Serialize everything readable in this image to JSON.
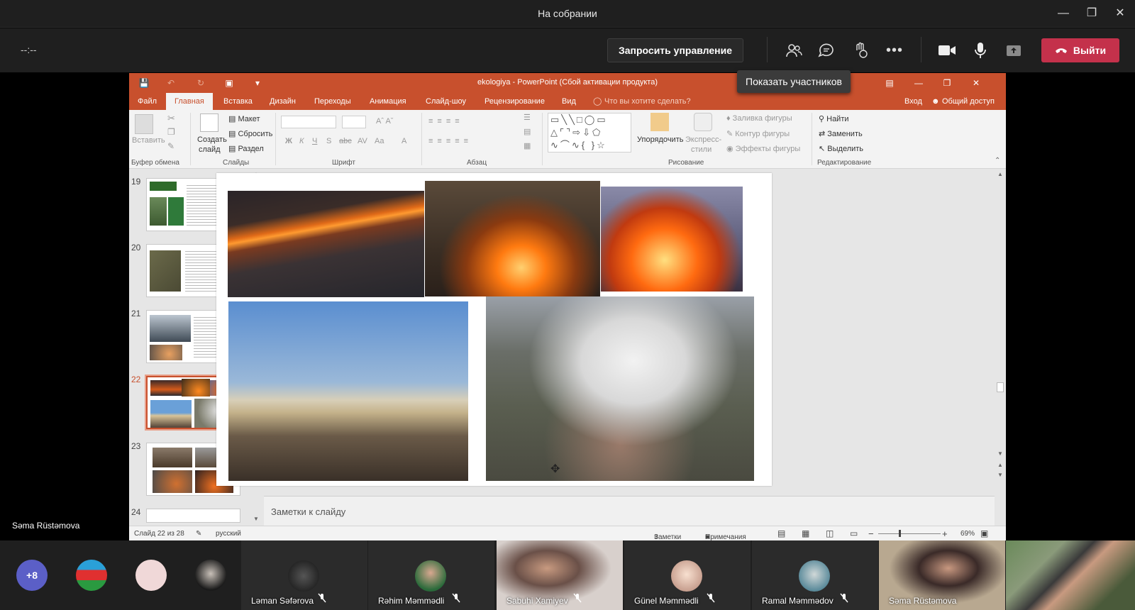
{
  "window": {
    "title": "На собрании"
  },
  "toolbar": {
    "timer": "--:--",
    "request_control": "Запросить управление",
    "leave": "Выйти"
  },
  "tooltip": "Показать участников",
  "presenter_label": "Səma Rüstəmova",
  "ppt": {
    "title": "ekologiya - PowerPoint (Сбой активации продукта)",
    "tabs": [
      "Файл",
      "Главная",
      "Вставка",
      "Дизайн",
      "Переходы",
      "Анимация",
      "Слайд-шоу",
      "Рецензирование",
      "Вид"
    ],
    "tell_me": "Что вы хотите сделать?",
    "signin": "Вход",
    "share": "Общий доступ",
    "ribbon": {
      "paste": "Вставить",
      "clipboard_group": "Буфер обмена",
      "new_slide_1": "Создать",
      "new_slide_2": "слайд",
      "layout": "Макет",
      "reset": "Сбросить",
      "section": "Раздел",
      "slides_group": "Слайды",
      "font_group": "Шрифт",
      "paragraph_group": "Абзац",
      "arrange": "Упорядочить",
      "quick_styles_1": "Экспресс-",
      "quick_styles_2": "стили",
      "shape_fill": "Заливка фигуры",
      "shape_outline": "Контур фигуры",
      "shape_effects": "Эффекты фигуры",
      "drawing_group": "Рисование",
      "find": "Найти",
      "replace": "Заменить",
      "select": "Выделить",
      "editing_group": "Редактирование"
    },
    "thumbnails": [
      "19",
      "20",
      "21",
      "22",
      "23",
      "24"
    ],
    "notes_placeholder": "Заметки к слайду",
    "status": {
      "slide_info": "Слайд 22 из 28",
      "language": "русский",
      "notes": "Заметки",
      "comments": "Примечания",
      "zoom": "69%"
    }
  },
  "participants": {
    "overflow": "+8",
    "tiles": [
      "Ləman Səfərova",
      "Rəhim Məmmədli",
      "Sabuhi Xamiyev",
      "Günel Məmmədli",
      "Ramal Məmmədov",
      "Səma Rüstəmova"
    ]
  },
  "colors": {
    "ppt_accent": "#c8502d",
    "leave": "#c4314b",
    "teams_dark": "#1f1f1f",
    "avatar_purple": "#5b5fc7"
  }
}
